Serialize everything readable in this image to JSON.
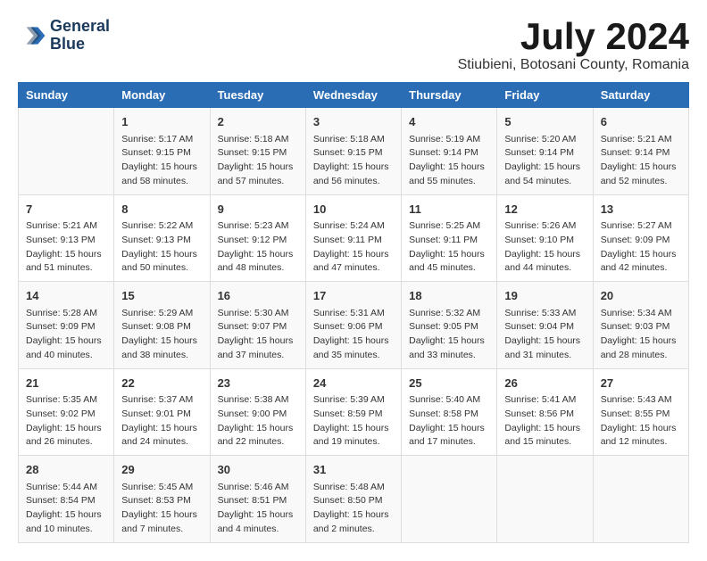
{
  "logo": {
    "line1": "General",
    "line2": "Blue"
  },
  "title": "July 2024",
  "location": "Stiubieni, Botosani County, Romania",
  "days_of_week": [
    "Sunday",
    "Monday",
    "Tuesday",
    "Wednesday",
    "Thursday",
    "Friday",
    "Saturday"
  ],
  "weeks": [
    [
      {
        "day": "",
        "content": ""
      },
      {
        "day": "1",
        "content": "Sunrise: 5:17 AM\nSunset: 9:15 PM\nDaylight: 15 hours\nand 58 minutes."
      },
      {
        "day": "2",
        "content": "Sunrise: 5:18 AM\nSunset: 9:15 PM\nDaylight: 15 hours\nand 57 minutes."
      },
      {
        "day": "3",
        "content": "Sunrise: 5:18 AM\nSunset: 9:15 PM\nDaylight: 15 hours\nand 56 minutes."
      },
      {
        "day": "4",
        "content": "Sunrise: 5:19 AM\nSunset: 9:14 PM\nDaylight: 15 hours\nand 55 minutes."
      },
      {
        "day": "5",
        "content": "Sunrise: 5:20 AM\nSunset: 9:14 PM\nDaylight: 15 hours\nand 54 minutes."
      },
      {
        "day": "6",
        "content": "Sunrise: 5:21 AM\nSunset: 9:14 PM\nDaylight: 15 hours\nand 52 minutes."
      }
    ],
    [
      {
        "day": "7",
        "content": "Sunrise: 5:21 AM\nSunset: 9:13 PM\nDaylight: 15 hours\nand 51 minutes."
      },
      {
        "day": "8",
        "content": "Sunrise: 5:22 AM\nSunset: 9:13 PM\nDaylight: 15 hours\nand 50 minutes."
      },
      {
        "day": "9",
        "content": "Sunrise: 5:23 AM\nSunset: 9:12 PM\nDaylight: 15 hours\nand 48 minutes."
      },
      {
        "day": "10",
        "content": "Sunrise: 5:24 AM\nSunset: 9:11 PM\nDaylight: 15 hours\nand 47 minutes."
      },
      {
        "day": "11",
        "content": "Sunrise: 5:25 AM\nSunset: 9:11 PM\nDaylight: 15 hours\nand 45 minutes."
      },
      {
        "day": "12",
        "content": "Sunrise: 5:26 AM\nSunset: 9:10 PM\nDaylight: 15 hours\nand 44 minutes."
      },
      {
        "day": "13",
        "content": "Sunrise: 5:27 AM\nSunset: 9:09 PM\nDaylight: 15 hours\nand 42 minutes."
      }
    ],
    [
      {
        "day": "14",
        "content": "Sunrise: 5:28 AM\nSunset: 9:09 PM\nDaylight: 15 hours\nand 40 minutes."
      },
      {
        "day": "15",
        "content": "Sunrise: 5:29 AM\nSunset: 9:08 PM\nDaylight: 15 hours\nand 38 minutes."
      },
      {
        "day": "16",
        "content": "Sunrise: 5:30 AM\nSunset: 9:07 PM\nDaylight: 15 hours\nand 37 minutes."
      },
      {
        "day": "17",
        "content": "Sunrise: 5:31 AM\nSunset: 9:06 PM\nDaylight: 15 hours\nand 35 minutes."
      },
      {
        "day": "18",
        "content": "Sunrise: 5:32 AM\nSunset: 9:05 PM\nDaylight: 15 hours\nand 33 minutes."
      },
      {
        "day": "19",
        "content": "Sunrise: 5:33 AM\nSunset: 9:04 PM\nDaylight: 15 hours\nand 31 minutes."
      },
      {
        "day": "20",
        "content": "Sunrise: 5:34 AM\nSunset: 9:03 PM\nDaylight: 15 hours\nand 28 minutes."
      }
    ],
    [
      {
        "day": "21",
        "content": "Sunrise: 5:35 AM\nSunset: 9:02 PM\nDaylight: 15 hours\nand 26 minutes."
      },
      {
        "day": "22",
        "content": "Sunrise: 5:37 AM\nSunset: 9:01 PM\nDaylight: 15 hours\nand 24 minutes."
      },
      {
        "day": "23",
        "content": "Sunrise: 5:38 AM\nSunset: 9:00 PM\nDaylight: 15 hours\nand 22 minutes."
      },
      {
        "day": "24",
        "content": "Sunrise: 5:39 AM\nSunset: 8:59 PM\nDaylight: 15 hours\nand 19 minutes."
      },
      {
        "day": "25",
        "content": "Sunrise: 5:40 AM\nSunset: 8:58 PM\nDaylight: 15 hours\nand 17 minutes."
      },
      {
        "day": "26",
        "content": "Sunrise: 5:41 AM\nSunset: 8:56 PM\nDaylight: 15 hours\nand 15 minutes."
      },
      {
        "day": "27",
        "content": "Sunrise: 5:43 AM\nSunset: 8:55 PM\nDaylight: 15 hours\nand 12 minutes."
      }
    ],
    [
      {
        "day": "28",
        "content": "Sunrise: 5:44 AM\nSunset: 8:54 PM\nDaylight: 15 hours\nand 10 minutes."
      },
      {
        "day": "29",
        "content": "Sunrise: 5:45 AM\nSunset: 8:53 PM\nDaylight: 15 hours\nand 7 minutes."
      },
      {
        "day": "30",
        "content": "Sunrise: 5:46 AM\nSunset: 8:51 PM\nDaylight: 15 hours\nand 4 minutes."
      },
      {
        "day": "31",
        "content": "Sunrise: 5:48 AM\nSunset: 8:50 PM\nDaylight: 15 hours\nand 2 minutes."
      },
      {
        "day": "",
        "content": ""
      },
      {
        "day": "",
        "content": ""
      },
      {
        "day": "",
        "content": ""
      }
    ]
  ]
}
